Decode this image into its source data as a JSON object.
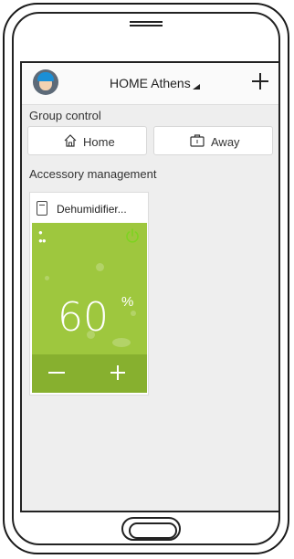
{
  "header": {
    "title": "HOME Athens"
  },
  "group_control": {
    "label": "Group control",
    "home_label": "Home",
    "away_label": "Away"
  },
  "accessories": {
    "label": "Accessory management",
    "devices": [
      {
        "name": "Dehumidifier...",
        "humidity": "60",
        "unit": "%",
        "power_color": "#7ed321"
      }
    ]
  },
  "colors": {
    "panel": "#9ec73e",
    "panel_footer": "#87b02f",
    "power_on": "#7ed321"
  }
}
